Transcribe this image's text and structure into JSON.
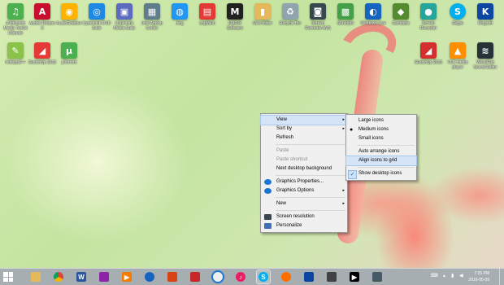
{
  "desktop_icons": [
    {
      "label": "4Videosoft Media Toolkit Ultimate",
      "glyph": "♫",
      "color": "#4caf50",
      "icon": "media-toolkit-icon"
    },
    {
      "label": "Adobe Reader X",
      "glyph": "A",
      "color": "#c8102e",
      "icon": "pdf-icon"
    },
    {
      "label": "AudioGrabber",
      "glyph": "◉",
      "color": "#ffb300",
      "icon": "headphones-icon"
    },
    {
      "label": "CyberLink DVD Suite",
      "glyph": "◎",
      "color": "#1e88e5",
      "icon": "disc-icon"
    },
    {
      "label": "CyberLink Media Suite",
      "glyph": "▣",
      "color": "#5c6bc0",
      "icon": "media-suite-icon"
    },
    {
      "label": "Intel AppUp Center",
      "glyph": "▦",
      "color": "#607d8b",
      "icon": "app-center-icon"
    },
    {
      "label": "Jing",
      "glyph": "◍",
      "color": "#2196f3",
      "icon": "jing-icon"
    },
    {
      "label": "LogMeIn",
      "glyph": "▤",
      "color": "#e53935",
      "icon": "logmein-icon"
    },
    {
      "label": "MAGIX Software",
      "glyph": "M",
      "color": "#212121",
      "icon": "magix-icon"
    },
    {
      "label": "New folder",
      "glyph": "▮",
      "color": "#e6b85c",
      "icon": "folder-icon"
    },
    {
      "label": "Recycle Bin",
      "glyph": "♻",
      "color": "#90a4ae",
      "icon": "recycle-bin-icon"
    },
    {
      "label": "Screen Recorder AVS",
      "glyph": "◙",
      "color": "#37474f",
      "icon": "recorder-icon"
    },
    {
      "label": "Shredder",
      "glyph": "▩",
      "color": "#43a047",
      "icon": "shredder-icon"
    },
    {
      "label": "Windows Live",
      "glyph": "◐",
      "color": "#1565c0",
      "icon": "live-icon"
    },
    {
      "label": "Camtasia",
      "glyph": "◆",
      "color": "#558b2f",
      "icon": "camtasia-icon"
    },
    {
      "label": "Screen Recorder",
      "glyph": "●",
      "color": "#26a69a",
      "icon": "screen-recorder-icon"
    },
    {
      "label": "Skype",
      "glyph": "S",
      "color": "#00aff0",
      "icon": "skype-icon"
    },
    {
      "label": "Kingsoft",
      "glyph": "K",
      "color": "#0d47a1",
      "icon": "kingsoft-icon"
    },
    {
      "label": "Notepad++",
      "glyph": "✎",
      "color": "#8bc34a",
      "icon": "notepad-icon"
    },
    {
      "label": "SketchUp 2015",
      "glyph": "◢",
      "color": "#e53935",
      "icon": "sketchup-icon"
    },
    {
      "label": "µTorrent",
      "glyph": "µ",
      "color": "#4caf50",
      "icon": "utorrent-icon"
    },
    {
      "label": "SketchUp 2015",
      "glyph": "◢",
      "color": "#d32f2f",
      "icon": "sketchup-2-icon"
    },
    {
      "label": "VLC media player",
      "glyph": "▲",
      "color": "#ff8f00",
      "icon": "vlc-icon"
    },
    {
      "label": "WavePad Sound Editor",
      "glyph": "≋",
      "color": "#263238",
      "icon": "wavepad-icon"
    }
  ],
  "context_menu": {
    "items": [
      {
        "label": "View",
        "submenu": true
      },
      {
        "label": "Sort by",
        "submenu": true
      },
      {
        "label": "Refresh"
      },
      {
        "label": "Paste",
        "disabled": true
      },
      {
        "label": "Paste shortcut",
        "disabled": true
      },
      {
        "label": "Next desktop background"
      },
      {
        "label": "Graphics Properties..."
      },
      {
        "label": "Graphics Options",
        "submenu": true
      },
      {
        "label": "New",
        "submenu": true
      },
      {
        "label": "Screen resolution"
      },
      {
        "label": "Personalize"
      }
    ]
  },
  "view_submenu": {
    "items": [
      {
        "label": "Large icons"
      },
      {
        "label": "Medium icons",
        "selected": true
      },
      {
        "label": "Small icons"
      },
      {
        "label": "Auto arrange icons"
      },
      {
        "label": "Align icons to grid"
      },
      {
        "label": "Show desktop icons",
        "checked": true
      }
    ]
  },
  "taskbar": {
    "clock_time": "7:35 PM",
    "clock_date": "2016-05-09"
  }
}
